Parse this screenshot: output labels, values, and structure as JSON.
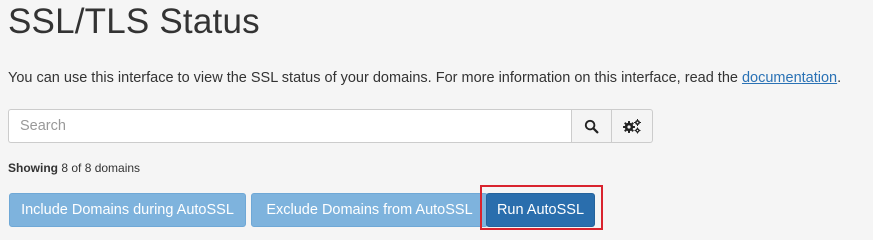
{
  "page": {
    "title": "SSL/TLS Status"
  },
  "intro": {
    "text": "You can use this interface to view the SSL status of your domains. For more information on this interface, read the ",
    "link_text": "documentation",
    "trailing": "."
  },
  "search": {
    "placeholder": "Search",
    "value": "",
    "search_icon": "search-icon",
    "settings_icon": "gears-icon"
  },
  "status": {
    "showing_label": "Showing",
    "showing_text": "8 of 8 domains"
  },
  "actions": {
    "include_label": "Include Domains during AutoSSL",
    "exclude_label": "Exclude Domains from AutoSSL",
    "run_label": "Run AutoSSL"
  },
  "colors": {
    "primary": "#2a6ead",
    "light_button": "#7eb3dd",
    "highlight": "#d9232e",
    "link": "#2a72b5"
  }
}
